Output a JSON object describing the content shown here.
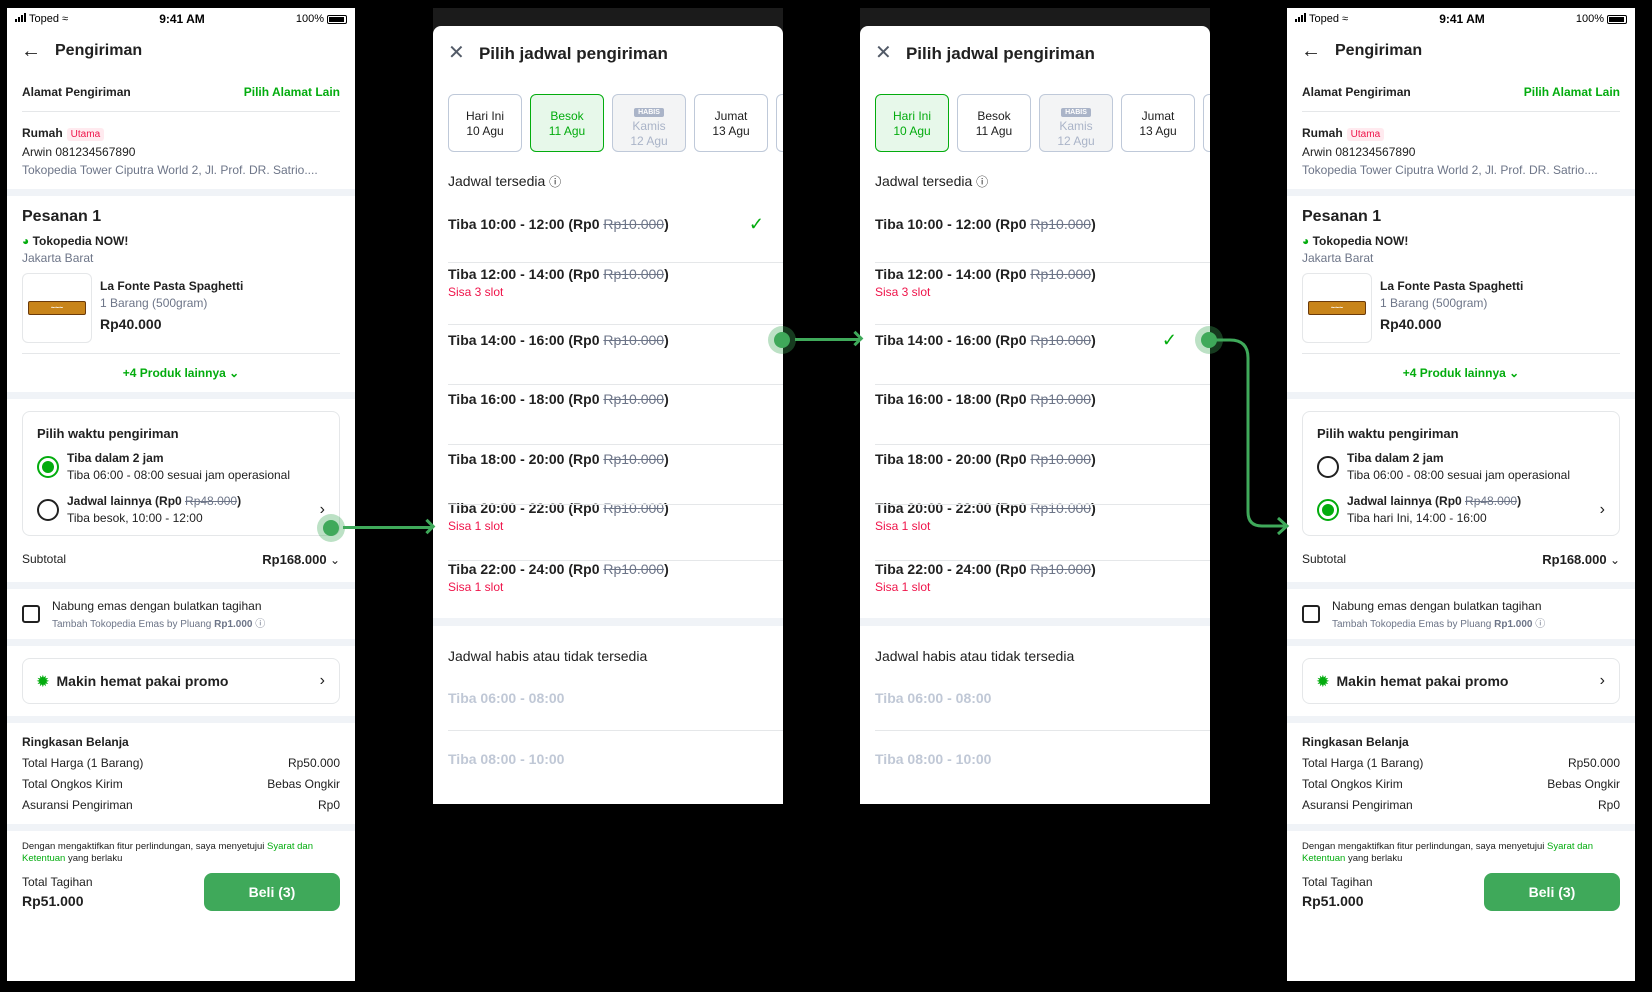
{
  "statusbar": {
    "carrier": "Toped",
    "time": "9:41 AM",
    "battery": "100%"
  },
  "checkout": {
    "title": "Pengiriman",
    "address_label": "Alamat Pengiriman",
    "address_action": "Pilih Alamat Lain",
    "address_name": "Rumah",
    "address_badge": "Utama",
    "address_person": "Arwin 081234567890",
    "address_line": "Tokopedia Tower Ciputra World 2, Jl. Prof. DR. Satrio....",
    "order_title": "Pesanan 1",
    "shop_name": "Tokopedia NOW!",
    "shop_city": "Jakarta Barat",
    "product_name": "La Fonte Pasta Spaghetti",
    "product_qty": "1 Barang (500gram)",
    "product_price": "Rp40.000",
    "more_products": "+4 Produk lainnya",
    "ship_title": "Pilih waktu pengiriman",
    "opt1_title": "Tiba dalam 2 jam",
    "opt1_sub": "Tiba 06:00 - 08:00 sesuai jam operasional",
    "opt2_title_prefix": "Jadwal lainnya (Rp0 ",
    "opt2_strike": "Rp48.000",
    "opt2_suffix": ")",
    "opt2_sub_before": "Tiba besok, 10:00 - 12:00",
    "opt2_sub_after": "Tiba hari Ini, 14:00 - 16:00",
    "subtotal_label": "Subtotal",
    "subtotal_value": "Rp168.000",
    "gold_title": "Nabung emas dengan bulatkan tagihan",
    "gold_sub_prefix": "Tambah Tokopedia Emas by Pluang ",
    "gold_sub_amount": "Rp1.000",
    "promo": "Makin hemat pakai promo",
    "summary_title": "Ringkasan Belanja",
    "summary_rows": [
      {
        "label": "Total Harga (1 Barang)",
        "value": "Rp50.000"
      },
      {
        "label": "Total Ongkos Kirim",
        "value": "Bebas Ongkir"
      },
      {
        "label": "Asuransi Pengiriman",
        "value": "Rp0"
      }
    ],
    "terms_prefix": "Dengan mengaktifkan fitur perlindungan, saya menyetujui ",
    "terms_link": "Syarat dan Ketentuan",
    "terms_suffix": " yang berlaku",
    "total_label": "Total Tagihan",
    "total_value": "Rp51.000",
    "buy_button": "Beli (3)"
  },
  "schedule": {
    "title": "Pilih jadwal pengiriman",
    "days": [
      {
        "line1": "Hari Ini",
        "line2": "10 Agu"
      },
      {
        "line1": "Besok",
        "line2": "11 Agu"
      },
      {
        "line1": "Kamis",
        "line2": "12 Agu",
        "badge": "HABIS"
      },
      {
        "line1": "Jumat",
        "line2": "13 Agu"
      }
    ],
    "available_title": "Jadwal tersedia",
    "slot_price": "(Rp0 ",
    "slot_strike": "Rp10.000",
    "slots": [
      {
        "time": "Tiba 10:00 - 12:00 ",
        "note": ""
      },
      {
        "time": "Tiba 12:00 - 14:00 ",
        "note": "Sisa 3 slot"
      },
      {
        "time": "Tiba 14:00 - 16:00 ",
        "note": ""
      },
      {
        "time": "Tiba 16:00 - 18:00 ",
        "note": ""
      },
      {
        "time": "Tiba 18:00 - 20:00 ",
        "note": ""
      },
      {
        "time": "Tiba 20:00 - 22:00 ",
        "note": "Sisa 1 slot"
      },
      {
        "time": "Tiba 22:00 - 24:00 ",
        "note": "Sisa 1 slot"
      }
    ],
    "unavailable_title": "Jadwal habis atau tidak tersedia",
    "unavailable_slots": [
      "Tiba 06:00 - 08:00",
      "Tiba 08:00 - 10:00"
    ]
  },
  "colors": {
    "accent": "#03AC0E",
    "flow": "#3FA95A",
    "alert": "#EF144A"
  }
}
